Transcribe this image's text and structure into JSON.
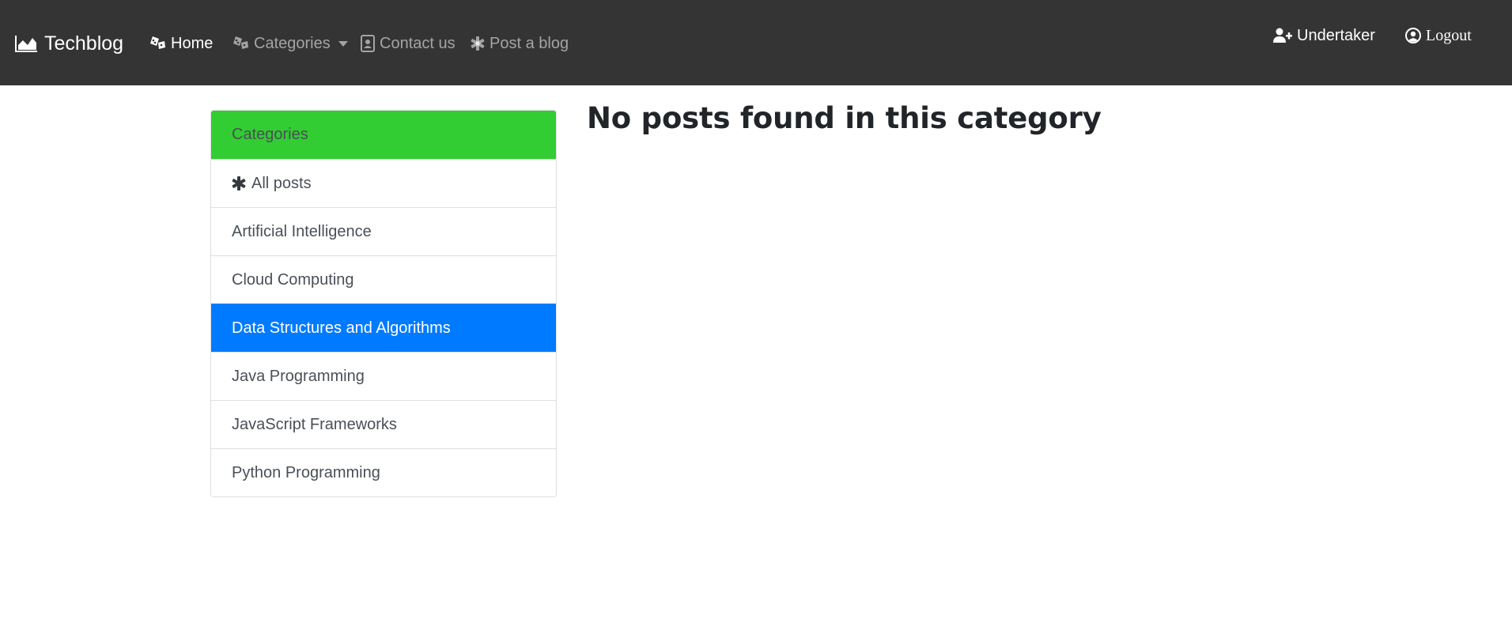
{
  "navbar": {
    "brand": {
      "label": "Techblog",
      "icon": "area-chart-icon"
    },
    "items": [
      {
        "label": "Home",
        "icon": "dice-icon",
        "active": true
      },
      {
        "label": "Categories",
        "icon": "dice-icon",
        "dropdown": true
      },
      {
        "label": "Contact us",
        "icon": "address-card-icon"
      },
      {
        "label": "Post a blog",
        "icon": "asterisk-icon"
      }
    ],
    "user": {
      "label": "Undertaker",
      "icon": "user-plus-icon"
    },
    "logout": {
      "label": "Logout",
      "icon": "user-circle-icon"
    }
  },
  "sidebar": {
    "header": "Categories",
    "items": [
      {
        "label": "All posts",
        "icon": "asterisk-icon",
        "active": false
      },
      {
        "label": "Artificial Intelligence",
        "active": false
      },
      {
        "label": "Cloud Computing",
        "active": false
      },
      {
        "label": "Data Structures and Algorithms",
        "active": true
      },
      {
        "label": "Java Programming",
        "active": false
      },
      {
        "label": "JavaScript Frameworks",
        "active": false
      },
      {
        "label": "Python Programming",
        "active": false
      }
    ]
  },
  "main": {
    "message": "No posts found in this category"
  },
  "colors": {
    "navbar_bg": "#343434",
    "header_green": "#32cd32",
    "active_blue": "#007bff"
  }
}
